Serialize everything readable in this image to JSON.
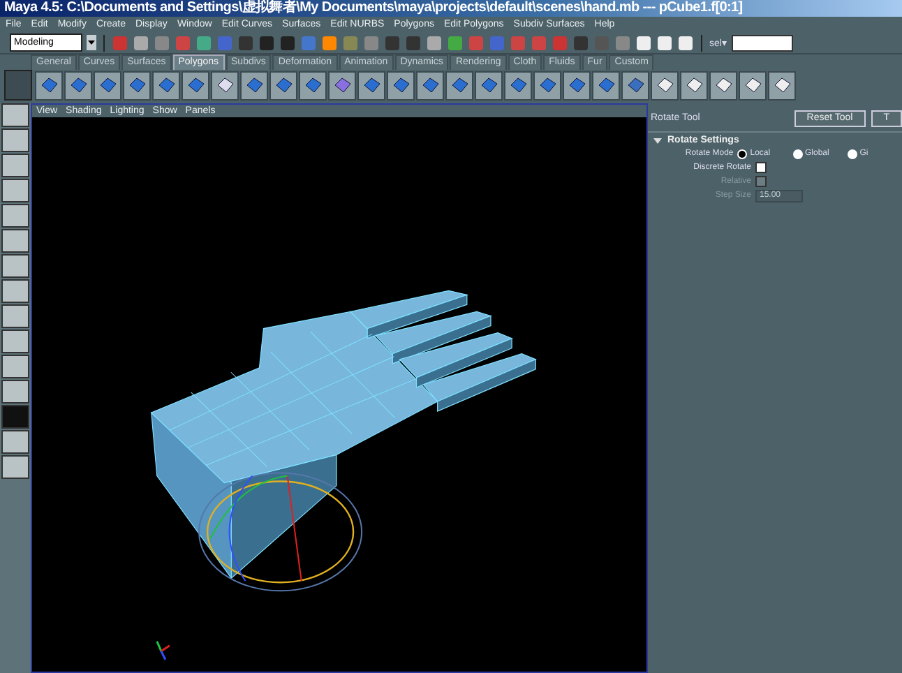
{
  "window": {
    "title": "Maya 4.5: C:\\Documents and Settings\\虚拟舞者\\My Documents\\maya\\projects\\default\\scenes\\hand.mb  ---  pCube1.f[0:1]"
  },
  "menu": [
    "File",
    "Edit",
    "Modify",
    "Create",
    "Display",
    "Window",
    "Edit Curves",
    "Surfaces",
    "Edit NURBS",
    "Polygons",
    "Edit Polygons",
    "Subdiv Surfaces",
    "Help"
  ],
  "status_line": {
    "mode": "Modeling",
    "selection_label": "sel▾"
  },
  "shelf_tabs": [
    {
      "label": "General",
      "selected": false
    },
    {
      "label": "Curves",
      "selected": false
    },
    {
      "label": "Surfaces",
      "selected": false
    },
    {
      "label": "Polygons",
      "selected": true
    },
    {
      "label": "Subdivs",
      "selected": false
    },
    {
      "label": "Deformation",
      "selected": false
    },
    {
      "label": "Animation",
      "selected": false
    },
    {
      "label": "Dynamics",
      "selected": false
    },
    {
      "label": "Rendering",
      "selected": false
    },
    {
      "label": "Cloth",
      "selected": false
    },
    {
      "label": "Fluids",
      "selected": false
    },
    {
      "label": "Fur",
      "selected": false
    },
    {
      "label": "Custom",
      "selected": false
    }
  ],
  "viewport": {
    "menu": [
      "View",
      "Shading",
      "Lighting",
      "Show",
      "Panels"
    ]
  },
  "tool_settings": {
    "title": "Rotate Tool",
    "buttons": [
      "Reset Tool",
      "T"
    ],
    "section": {
      "title": "Rotate Settings",
      "expanded": true
    },
    "rotate_mode": {
      "label": "Rotate Mode",
      "options": [
        {
          "label": "Local",
          "selected": true
        },
        {
          "label": "Global",
          "selected": false
        },
        {
          "label": "Gi",
          "selected": false
        }
      ]
    },
    "rows": [
      {
        "kind": "checkbox",
        "label": "Discrete Rotate",
        "checked": false,
        "disabled": false
      },
      {
        "kind": "checkbox",
        "label": "Relative",
        "checked": false,
        "disabled": true
      },
      {
        "kind": "field",
        "label": "Step Size",
        "value": "15.00",
        "disabled": true
      }
    ]
  }
}
